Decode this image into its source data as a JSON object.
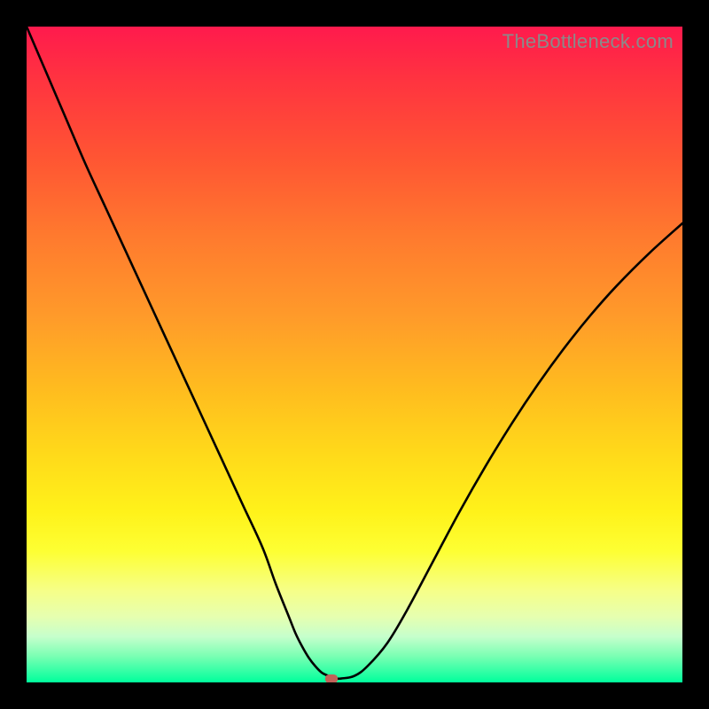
{
  "watermark": "TheBottleneck.com",
  "chart_data": {
    "type": "line",
    "title": "",
    "xlabel": "",
    "ylabel": "",
    "xlim": [
      0,
      100
    ],
    "ylim": [
      0,
      100
    ],
    "x": [
      0,
      3,
      6,
      9,
      12,
      15,
      18,
      21,
      24,
      27,
      30,
      33,
      36,
      38,
      40,
      41,
      42,
      43,
      44,
      45,
      46,
      47,
      48,
      50,
      52,
      55,
      58,
      62,
      66,
      70,
      74,
      78,
      82,
      86,
      90,
      95,
      100
    ],
    "y": [
      100,
      93,
      86,
      79,
      72.5,
      66,
      59.5,
      53,
      46.5,
      40,
      33.5,
      27,
      20.5,
      15,
      10,
      7.5,
      5.5,
      3.8,
      2.5,
      1.5,
      1.0,
      0.6,
      0.6,
      1.0,
      2.5,
      6.0,
      11.0,
      18.5,
      26.0,
      33.0,
      39.5,
      45.5,
      51.0,
      56.0,
      60.5,
      65.5,
      70.0
    ],
    "marker": {
      "x": 46.5,
      "y": 0.6
    },
    "gradient_stops": [
      {
        "pos": 0,
        "color": "#ff1a4d"
      },
      {
        "pos": 55,
        "color": "#ffbb1f"
      },
      {
        "pos": 80,
        "color": "#fdff33"
      },
      {
        "pos": 100,
        "color": "#00ff9c"
      }
    ]
  }
}
